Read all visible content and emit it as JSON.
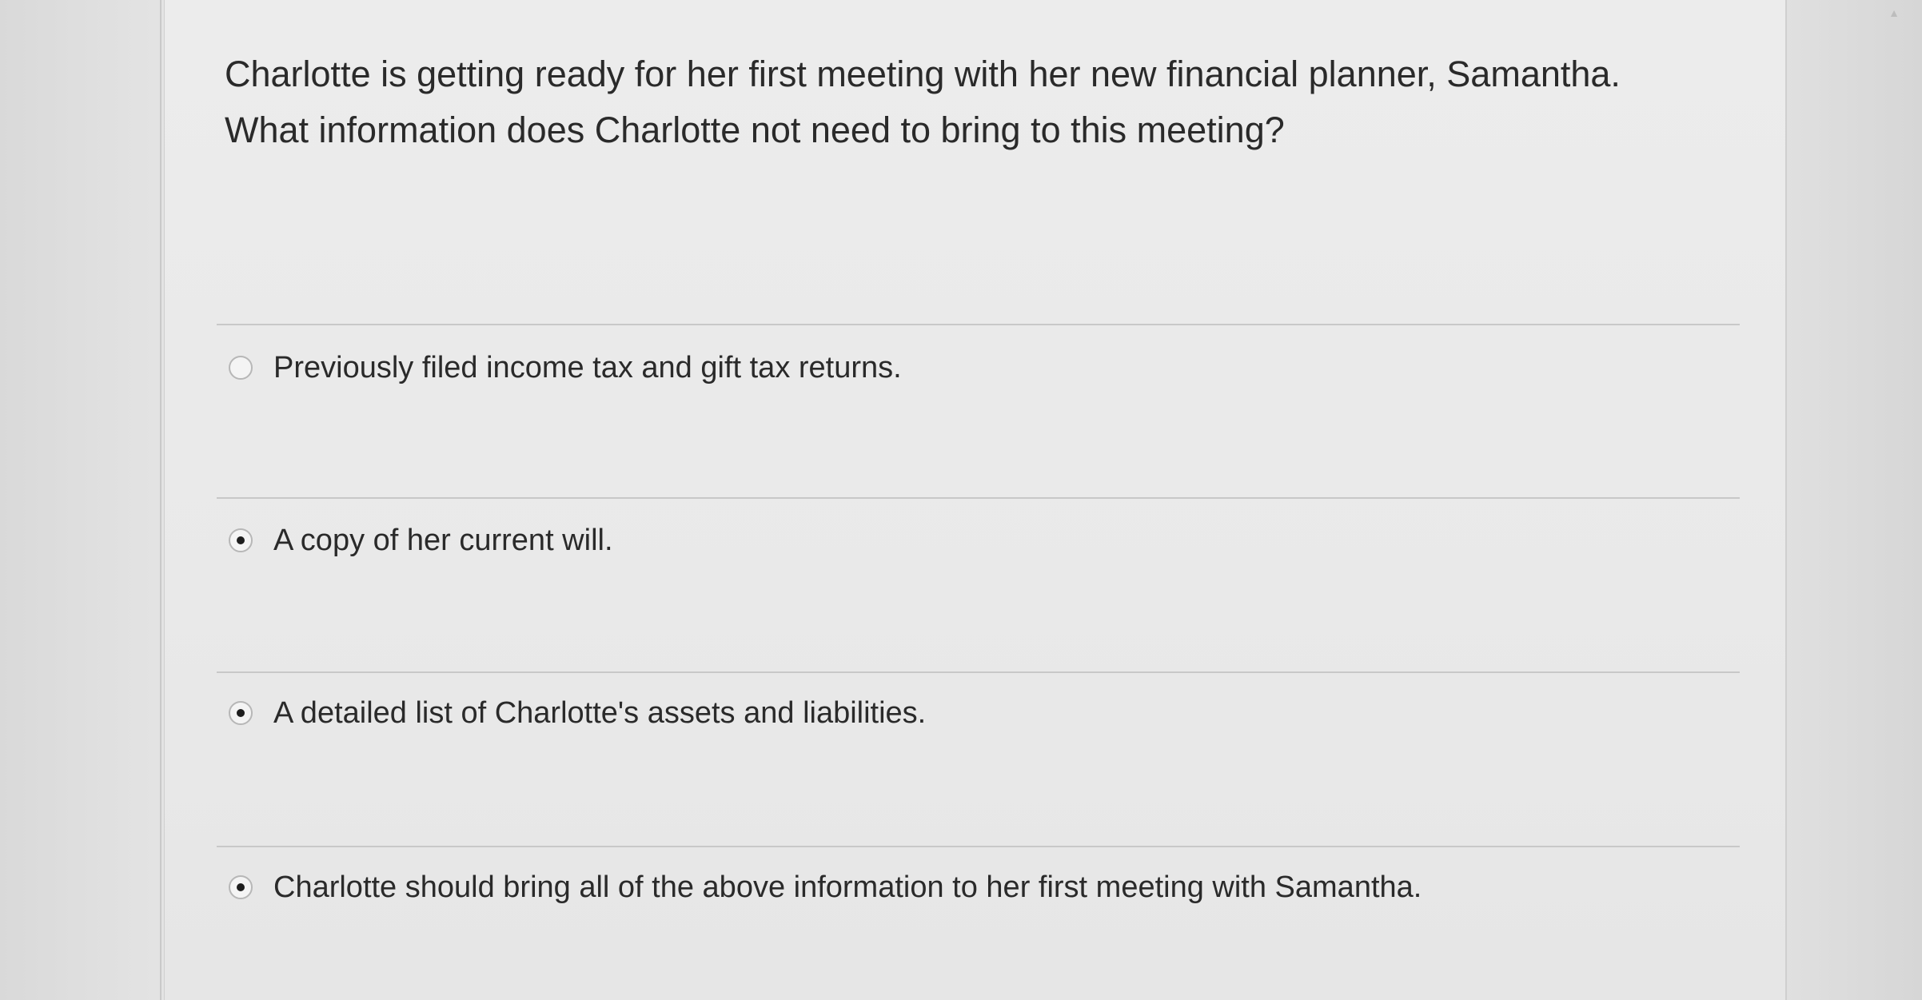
{
  "question": {
    "line1": "Charlotte is getting ready for her first meeting with her new financial planner, Samantha.",
    "line2": "What information does Charlotte not need to bring to this meeting?"
  },
  "options": [
    {
      "label": "Previously filed income tax and gift tax returns.",
      "selected": false
    },
    {
      "label": "A copy of her current will.",
      "selected": true
    },
    {
      "label": "A detailed list of Charlotte's assets and liabilities.",
      "selected": true
    },
    {
      "label": "Charlotte should bring all of the above information to her first meeting with Samantha.",
      "selected": true
    }
  ],
  "icons": {
    "radio": "radio-button-icon",
    "scroll": "scroll-up-arrow-icon"
  },
  "colors": {
    "text": "#2a2a2a",
    "background": "#e9e9e9",
    "divider": "#c8c8c8",
    "radio_dot": "#1e1e1e"
  }
}
